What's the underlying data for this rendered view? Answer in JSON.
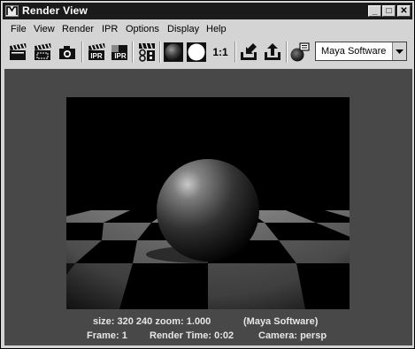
{
  "window": {
    "title": "Render View",
    "controls": {
      "minimize": "_",
      "maximize": "□",
      "close": "✕"
    }
  },
  "menu": [
    {
      "label": "File"
    },
    {
      "label": "View"
    },
    {
      "label": "Render"
    },
    {
      "label": "IPR"
    },
    {
      "label": "Options"
    },
    {
      "label": "Display"
    },
    {
      "label": "Help"
    }
  ],
  "toolbar": {
    "buttons": [
      {
        "icon": "clapper-icon",
        "label": ""
      },
      {
        "icon": "clapper-region-icon",
        "label": ""
      },
      {
        "icon": "camera-snapshot-icon",
        "label": ""
      },
      {
        "icon": "ipr-render-icon",
        "label": "IPR"
      },
      {
        "icon": "ipr-refresh-icon",
        "label": "IPR"
      },
      {
        "icon": "render-settings-icon",
        "label": ""
      },
      {
        "icon": "rgb-channel-icon",
        "label": ""
      },
      {
        "icon": "alpha-channel-icon",
        "label": ""
      },
      {
        "icon": "real-size-icon",
        "label": "1:1"
      },
      {
        "icon": "keep-image-icon",
        "label": ""
      },
      {
        "icon": "remove-image-icon",
        "label": ""
      },
      {
        "icon": "render-globals-icon",
        "label": ""
      }
    ],
    "renderer": "Maya Software"
  },
  "status": {
    "size_line": "size:  320  240 zoom: 1.000",
    "renderer_tag": "(Maya Software)",
    "frame": "Frame: 1",
    "render_time": "Render Time: 0:02",
    "camera": "Camera: persp"
  }
}
